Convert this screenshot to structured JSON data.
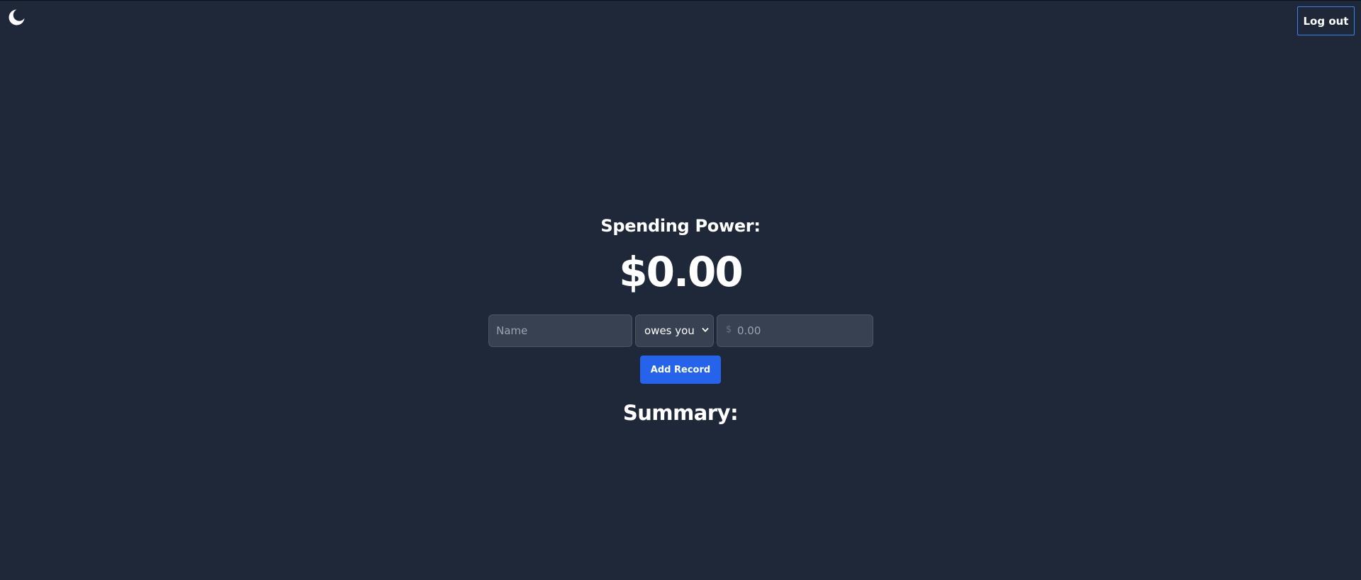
{
  "header": {
    "theme_icon": "moon-icon",
    "logout_label": "Log out"
  },
  "main": {
    "spending_label": "Spending Power:",
    "spending_value": "$0.00",
    "form": {
      "name_placeholder": "Name",
      "direction_selected": "owes you",
      "currency_symbol": "$",
      "amount_placeholder": "0.00",
      "add_label": "Add Record"
    },
    "summary_heading": "Summary:"
  },
  "colors": {
    "background": "#1f2838",
    "input_background": "#374151",
    "accent": "#2563eb",
    "logout_border": "#3b82f6"
  }
}
